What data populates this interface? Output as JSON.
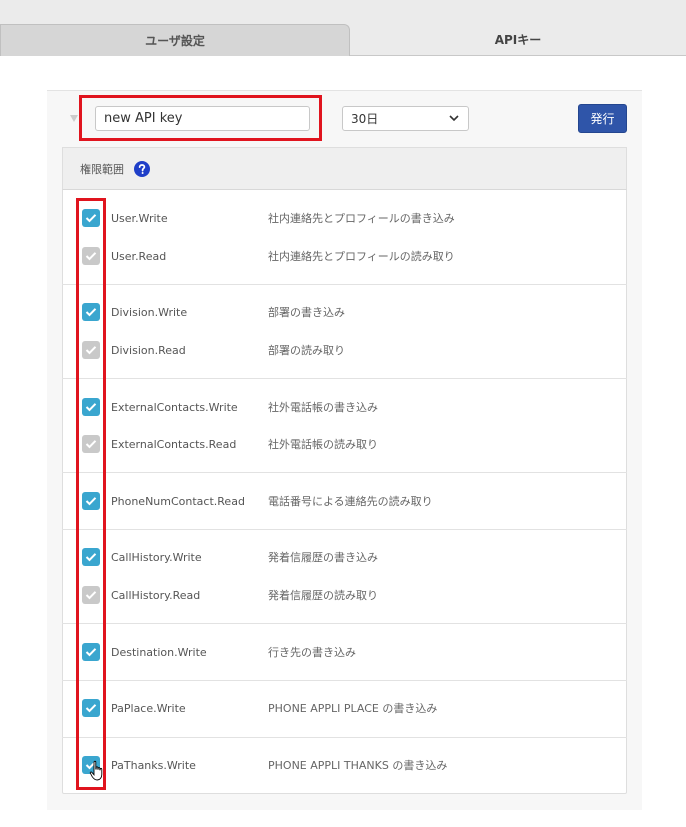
{
  "tabs": [
    {
      "label": "ユーザ設定",
      "active": false
    },
    {
      "label": "APIキー",
      "active": true
    }
  ],
  "form": {
    "key_name_value": "new API key",
    "period_value": "30日",
    "issue_label": "発行"
  },
  "scope": {
    "header_label": "権限範囲",
    "help_icon": "question-circle-icon",
    "items": [
      {
        "name": "User.Write",
        "desc": "社内連絡先とプロフィールの書き込み",
        "checked": true
      },
      {
        "name": "User.Read",
        "desc": "社内連絡先とプロフィールの読み取り",
        "checked": false
      },
      {
        "name": "Division.Write",
        "desc": "部署の書き込み",
        "checked": true
      },
      {
        "name": "Division.Read",
        "desc": "部署の読み取り",
        "checked": false
      },
      {
        "name": "ExternalContacts.Write",
        "desc": "社外電話帳の書き込み",
        "checked": true
      },
      {
        "name": "ExternalContacts.Read",
        "desc": "社外電話帳の読み取り",
        "checked": false
      },
      {
        "name": "PhoneNumContact.Read",
        "desc": "電話番号による連絡先の読み取り",
        "checked": true
      },
      {
        "name": "CallHistory.Write",
        "desc": "発着信履歴の書き込み",
        "checked": true
      },
      {
        "name": "CallHistory.Read",
        "desc": "発着信履歴の読み取り",
        "checked": false
      },
      {
        "name": "Destination.Write",
        "desc": "行き先の書き込み",
        "checked": true
      },
      {
        "name": "PaPlace.Write",
        "desc": "PHONE APPLI PLACE の書き込み",
        "checked": true
      },
      {
        "name": "PaThanks.Write",
        "desc": "PHONE APPLI THANKS の書き込み",
        "checked": true
      }
    ]
  },
  "colors": {
    "accent": "#2f55a9",
    "checkbox_on": "#3aa6cf",
    "checkbox_off": "#c9c9c9",
    "highlight": "#e0141e"
  }
}
